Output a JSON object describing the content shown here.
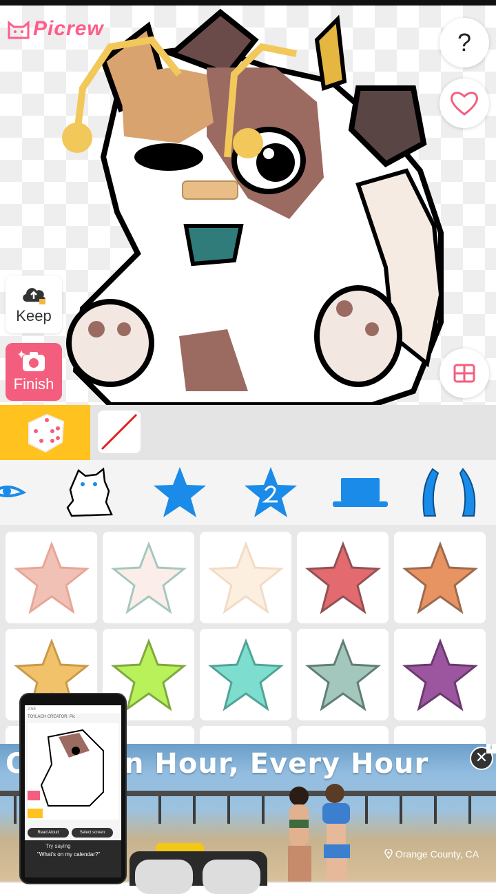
{
  "app": {
    "logo_text": "Picrew"
  },
  "canvas": {
    "help_label": "?",
    "keep_label": "Keep",
    "finish_label": "Finish"
  },
  "ad": {
    "headline_left": "O",
    "headline": "n Hour, Every Hour",
    "location": "Orange County, CA",
    "close_label": "✕",
    "badge": "i",
    "thumb": {
      "status": "2:59",
      "title": "TO'ILACH CREATOR: Pic",
      "pill1": "Read Aloud",
      "pill2": "Select screen",
      "try_saying": "Try saying",
      "prompt": "\"What's on my calendar?\""
    }
  },
  "colors": {
    "accent_pink": "#f45e7e",
    "dice_yellow": "#ffc21f",
    "tab_blue": "#1a8be8",
    "swatches": [
      "#f1c1b5",
      "#fbeeea",
      "#fcefe0",
      "#e36a6e",
      "#e79462",
      "#f2c26a",
      "#b8f15a",
      "#7dded0",
      "#a3c7bd",
      "#9c56a0"
    ]
  }
}
